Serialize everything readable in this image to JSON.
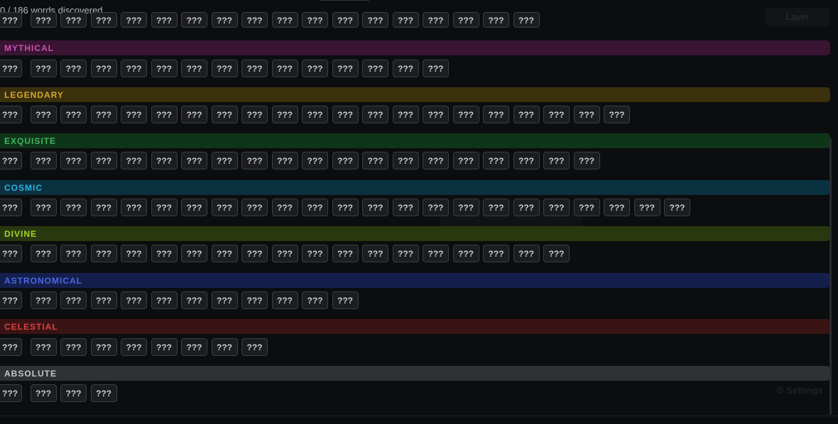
{
  "progress": {
    "text": "0 / 186 words discovered",
    "discovered": 0,
    "total": 186
  },
  "tile_label": "???",
  "background": {
    "layer_button": "Layer",
    "settings": "Settings"
  },
  "tiers": [
    {
      "name": "",
      "color": "",
      "bg": "",
      "count": 18,
      "partial": true
    },
    {
      "name": "MYTHICAL",
      "color": "#c94fb0",
      "bg": "#3a1433",
      "count": 15
    },
    {
      "name": "LEGENDARY",
      "color": "#d4a72c",
      "bg": "#3a300c",
      "count": 21
    },
    {
      "name": "EXQUISITE",
      "color": "#3fb561",
      "bg": "#0f3519",
      "count": 20
    },
    {
      "name": "COSMIC",
      "color": "#29b4e0",
      "bg": "#0a3140",
      "count": 23
    },
    {
      "name": "DIVINE",
      "color": "#a3d629",
      "bg": "#2a3810",
      "count": 19
    },
    {
      "name": "ASTRONOMICAL",
      "color": "#4a68e6",
      "bg": "#141f4d",
      "count": 12
    },
    {
      "name": "CELESTIAL",
      "color": "#d6443f",
      "bg": "#3a1314",
      "count": 9
    },
    {
      "name": "ABSOLUTE",
      "color": "#c3c5c8",
      "bg": "#2f3134",
      "count": 4
    }
  ]
}
